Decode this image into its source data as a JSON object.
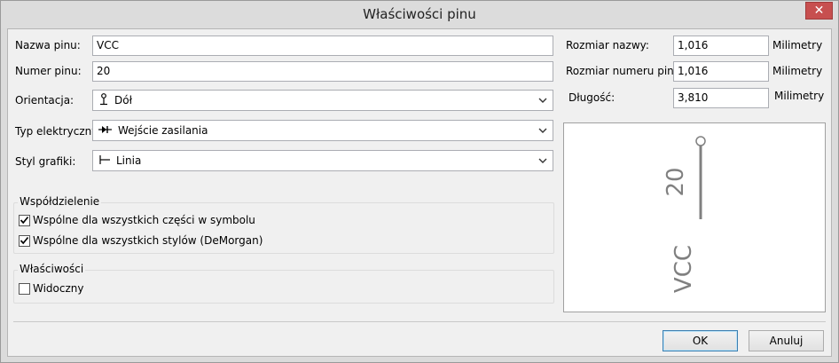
{
  "window": {
    "title": "Właściwości pinu",
    "close_glyph": "✕"
  },
  "form": {
    "pin_name_label": "Nazwa pinu:",
    "pin_name_value": "VCC",
    "pin_number_label": "Numer pinu:",
    "pin_number_value": "20",
    "orientation_label": "Orientacja:",
    "orientation_value": "Dół",
    "electrical_type_label": "Typ elektryczny:",
    "electrical_type_value": "Wejście zasilania",
    "graphic_style_label": "Styl grafiki:",
    "graphic_style_value": "Linia",
    "name_size_label": "Rozmiar nazwy:",
    "name_size_value": "1,016",
    "name_size_unit": "Milimetry",
    "number_size_label": "Rozmiar numeru pinu:",
    "number_size_value": "1,016",
    "number_size_unit": "Milimetry",
    "length_label": "Długość:",
    "length_value": "3,810",
    "length_unit": "Milimetry"
  },
  "sharing": {
    "title": "Współdzielenie",
    "all_parts_label": "Wspólne dla wszystkich części w symbolu",
    "all_parts_checked": true,
    "all_styles_label": "Wspólne dla wszystkich stylów (DeMorgan)",
    "all_styles_checked": true
  },
  "properties": {
    "title": "Właściwości",
    "visible_label": "Widoczny",
    "visible_checked": false
  },
  "preview": {
    "pin_name": "VCC",
    "pin_number": "20"
  },
  "buttons": {
    "ok": "OK",
    "cancel": "Anuluj"
  },
  "colors": {
    "preview_pin": "#808080",
    "close_button": "#c74f4f"
  }
}
